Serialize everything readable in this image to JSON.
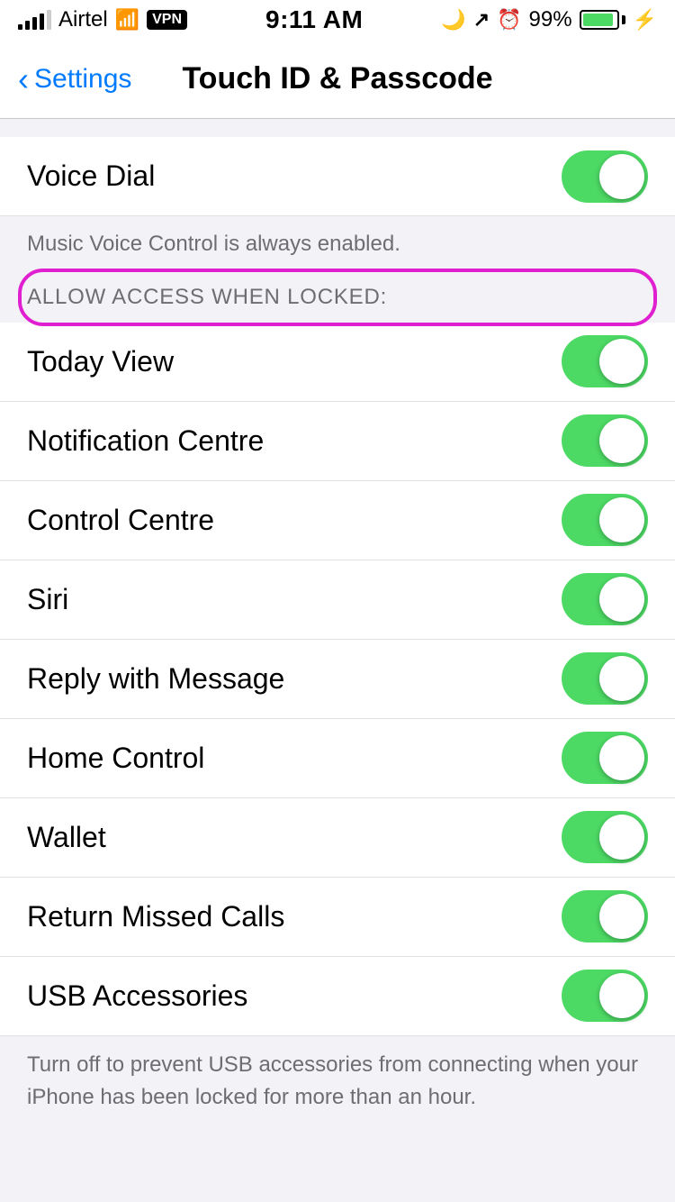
{
  "statusBar": {
    "carrier": "Airtel",
    "time": "9:11 AM",
    "battery": "99%",
    "vpn": "VPN"
  },
  "navBar": {
    "backLabel": "Settings",
    "title": "Touch ID & Passcode"
  },
  "sections": [
    {
      "id": "voice-dial",
      "rows": [
        {
          "id": "voice-dial-row",
          "label": "Voice Dial",
          "toggle": true
        }
      ],
      "footer": "Music Voice Control is always enabled."
    },
    {
      "id": "allow-access",
      "header": "ALLOW ACCESS WHEN LOCKED:",
      "headerHighlighted": true,
      "rows": [
        {
          "id": "today-view",
          "label": "Today View",
          "toggle": true
        },
        {
          "id": "notification-centre",
          "label": "Notification Centre",
          "toggle": true
        },
        {
          "id": "control-centre",
          "label": "Control Centre",
          "toggle": true
        },
        {
          "id": "siri",
          "label": "Siri",
          "toggle": true
        },
        {
          "id": "reply-with-message",
          "label": "Reply with Message",
          "toggle": true
        },
        {
          "id": "home-control",
          "label": "Home Control",
          "toggle": true
        },
        {
          "id": "wallet",
          "label": "Wallet",
          "toggle": true
        },
        {
          "id": "return-missed-calls",
          "label": "Return Missed Calls",
          "toggle": true
        },
        {
          "id": "usb-accessories",
          "label": "USB Accessories",
          "toggle": true
        }
      ],
      "footer": "Turn off to prevent USB accessories from connecting when your iPhone has been locked for more than an hour."
    }
  ]
}
